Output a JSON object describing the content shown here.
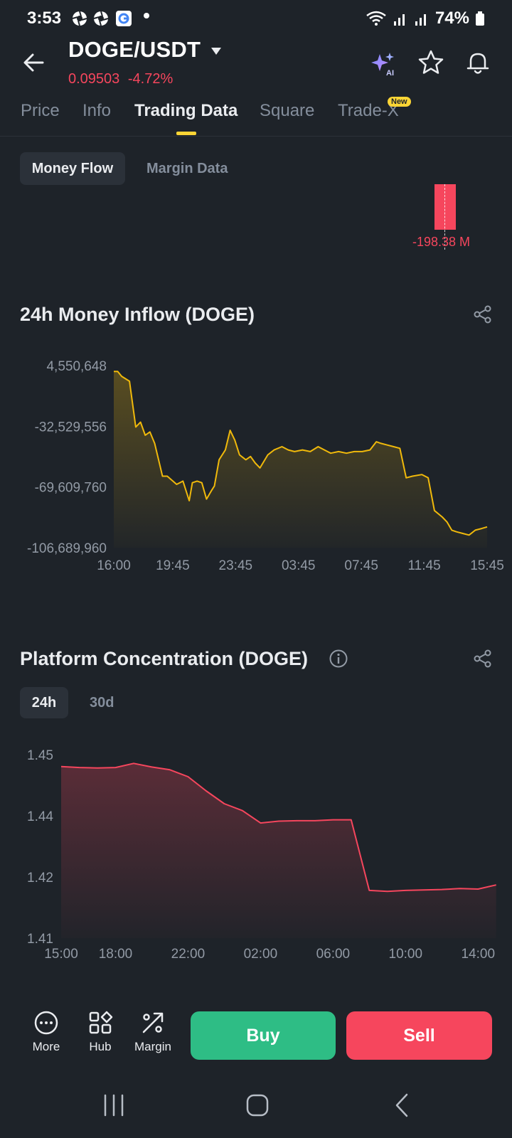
{
  "status_bar": {
    "time": "3:53",
    "battery": "74%"
  },
  "header": {
    "pair": "DOGE/USDT",
    "price": "0.09503",
    "change": "-4.72%",
    "icons": [
      "back-arrow-icon",
      "ai-sparkle-icon",
      "star-icon",
      "bell-icon"
    ]
  },
  "tabs": [
    {
      "label": "Price",
      "active": false
    },
    {
      "label": "Info",
      "active": false
    },
    {
      "label": "Trading Data",
      "active": true
    },
    {
      "label": "Square",
      "active": false
    },
    {
      "label": "Trade-X",
      "active": false,
      "badge": "New"
    }
  ],
  "segments": {
    "money_flow": "Money Flow",
    "margin_data": "Margin Data",
    "selected": "Money Flow"
  },
  "money_flow_top": {
    "value_label": "-198.38 M"
  },
  "inflow_section": {
    "title": "24h Money Inflow (DOGE)"
  },
  "concentration_section": {
    "title": "Platform Concentration (DOGE)",
    "range_24h": "24h",
    "range_30d": "30d",
    "selected_range": "24h"
  },
  "chart_data": [
    {
      "type": "area",
      "title": "24h Money Inflow (DOGE)",
      "color": "#f0b90b",
      "y_ticks": [
        "4,550,648",
        "-32,529,556",
        "-69,609,760",
        "-106,689,960"
      ],
      "ylim": [
        -106689960,
        4550648
      ],
      "x_ticks": [
        "16:00",
        "19:45",
        "23:45",
        "03:45",
        "07:45",
        "11:45",
        "15:45"
      ],
      "x_hours": [
        0,
        3.75,
        7.75,
        11.75,
        15.75,
        19.75,
        23.75
      ],
      "series": [
        {
          "x": [
            0,
            0.25,
            0.5,
            1.0,
            1.4,
            1.7,
            2.0,
            2.3,
            2.6,
            3.1,
            3.4,
            4.0,
            4.4,
            4.8,
            5.0,
            5.3,
            5.6,
            5.9,
            6.2,
            6.4,
            6.7,
            7.1,
            7.4,
            7.7,
            8.0,
            8.4,
            8.7,
            9.0,
            9.3,
            9.8,
            10.2,
            10.7,
            11.1,
            11.5,
            12.0,
            12.5,
            13.0,
            13.4,
            13.8,
            14.3,
            14.8,
            15.3,
            15.8,
            16.3,
            16.7,
            17.0,
            17.4,
            17.8,
            18.2,
            18.6,
            19.0,
            19.6,
            20.0,
            20.4,
            20.9,
            21.2,
            21.5,
            21.8,
            22.2,
            22.6,
            23.0,
            23.4,
            23.75
          ],
          "values": [
            1000000,
            1000000,
            -2000000,
            -5000000,
            -33000000,
            -30000000,
            -38000000,
            -36000000,
            -43000000,
            -63000000,
            -63000000,
            -68000000,
            -66000000,
            -78000000,
            -67000000,
            -66000000,
            -67000000,
            -77000000,
            -72000000,
            -69000000,
            -53000000,
            -47000000,
            -35000000,
            -41000000,
            -50000000,
            -53000000,
            -51000000,
            -55000000,
            -58000000,
            -50000000,
            -47000000,
            -45000000,
            -47000000,
            -48000000,
            -47000000,
            -48000000,
            -45000000,
            -47000000,
            -49000000,
            -48000000,
            -49000000,
            -48000000,
            -48000000,
            -47000000,
            -42000000,
            -43000000,
            -44000000,
            -45000000,
            -46000000,
            -64000000,
            -63000000,
            -62000000,
            -64000000,
            -84000000,
            -88000000,
            -91000000,
            -96000000,
            -97000000,
            -98000000,
            -99000000,
            -96000000,
            -95000000,
            -94000000
          ]
        }
      ]
    },
    {
      "type": "area",
      "title": "Platform Concentration (DOGE)",
      "color": "#f6465d",
      "y_ticks": [
        "1.45",
        "1.44",
        "1.42",
        "1.41"
      ],
      "ylim": [
        1.41,
        1.45
      ],
      "x_ticks": [
        "15:00",
        "18:00",
        "22:00",
        "02:00",
        "06:00",
        "10:00",
        "14:00"
      ],
      "x_hours": [
        0,
        3,
        7,
        11,
        15,
        19,
        23
      ],
      "series": [
        {
          "x": [
            0,
            1,
            2,
            3,
            4,
            5,
            6,
            7,
            8,
            9,
            10,
            11,
            12,
            13,
            14,
            15,
            16,
            17,
            18,
            19,
            20,
            21,
            22,
            23,
            24
          ],
          "values": [
            1.4474,
            1.4472,
            1.4471,
            1.4472,
            1.4481,
            1.4473,
            1.4467,
            1.4452,
            1.4421,
            1.4393,
            1.4378,
            1.4351,
            1.4355,
            1.4356,
            1.4356,
            1.4358,
            1.4358,
            1.4204,
            1.4202,
            1.4204,
            1.4205,
            1.4206,
            1.4208,
            1.4207,
            1.4216
          ]
        }
      ]
    }
  ],
  "bottom_bar": {
    "more": "More",
    "hub": "Hub",
    "margin": "Margin",
    "buy": "Buy",
    "sell": "Sell"
  }
}
